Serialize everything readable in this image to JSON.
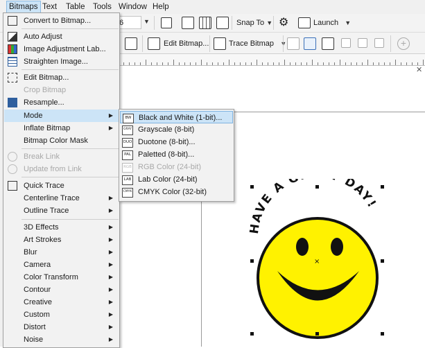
{
  "menubar": {
    "items": [
      {
        "label": "Bitmaps",
        "active": true
      },
      {
        "label": "Text"
      },
      {
        "label": "Table"
      },
      {
        "label": "Tools"
      },
      {
        "label": "Window"
      },
      {
        "label": "Help"
      }
    ]
  },
  "toolbar1": {
    "field_value": "6",
    "snap_to_label": "Snap To",
    "launch_label": "Launch"
  },
  "toolbar2": {
    "edit_bitmap_label": "Edit Bitmap...",
    "trace_bitmap_label": "Trace Bitmap"
  },
  "bitmaps_menu": {
    "items": [
      {
        "label": "Convert to Bitmap...",
        "icon": "convert-bitmap-icon"
      },
      {
        "label": "Auto Adjust",
        "icon": "auto-adjust-icon"
      },
      {
        "label": "Image Adjustment Lab...",
        "icon": "image-adjustment-icon"
      },
      {
        "label": "Straighten Image...",
        "icon": "straighten-icon"
      },
      {
        "label": "Edit Bitmap...",
        "icon": "edit-bitmap-icon"
      },
      {
        "label": "Crop Bitmap",
        "icon": "",
        "disabled": true
      },
      {
        "label": "Resample...",
        "icon": "resample-icon"
      },
      {
        "label": "Mode",
        "submenu": true,
        "highlighted": true
      },
      {
        "label": "Inflate Bitmap",
        "submenu": true
      },
      {
        "label": "Bitmap Color Mask"
      },
      {
        "label": "Break Link",
        "icon": "break-link-icon",
        "disabled": true
      },
      {
        "label": "Update from Link",
        "icon": "update-link-icon",
        "disabled": true
      },
      {
        "label": "Quick Trace",
        "icon": "quick-trace-icon"
      },
      {
        "label": "Centerline Trace",
        "submenu": true
      },
      {
        "label": "Outline Trace",
        "submenu": true
      },
      {
        "label": "3D Effects",
        "submenu": true
      },
      {
        "label": "Art Strokes",
        "submenu": true
      },
      {
        "label": "Blur",
        "submenu": true
      },
      {
        "label": "Camera",
        "submenu": true
      },
      {
        "label": "Color Transform",
        "submenu": true
      },
      {
        "label": "Contour",
        "submenu": true
      },
      {
        "label": "Creative",
        "submenu": true
      },
      {
        "label": "Custom",
        "submenu": true
      },
      {
        "label": "Distort",
        "submenu": true
      },
      {
        "label": "Noise",
        "submenu": true
      }
    ]
  },
  "mode_submenu": {
    "items": [
      {
        "label": "Black and White (1-bit)...",
        "badge": "BW",
        "highlighted": true
      },
      {
        "label": "Grayscale (8-bit)",
        "badge": "GRAY"
      },
      {
        "label": "Duotone (8-bit)...",
        "badge": "DUO"
      },
      {
        "label": "Paletted (8-bit)...",
        "badge": "PAL"
      },
      {
        "label": "RGB Color (24-bit)",
        "badge": "RGB",
        "disabled": true
      },
      {
        "label": "Lab Color (24-bit)",
        "badge": "LAB"
      },
      {
        "label": "CMYK Color (32-bit)",
        "badge": "CMYK"
      }
    ]
  },
  "artwork": {
    "arc_text": "HAVE A GREAT DAY!",
    "face_color": "#fff200",
    "outline_color": "#111111"
  }
}
